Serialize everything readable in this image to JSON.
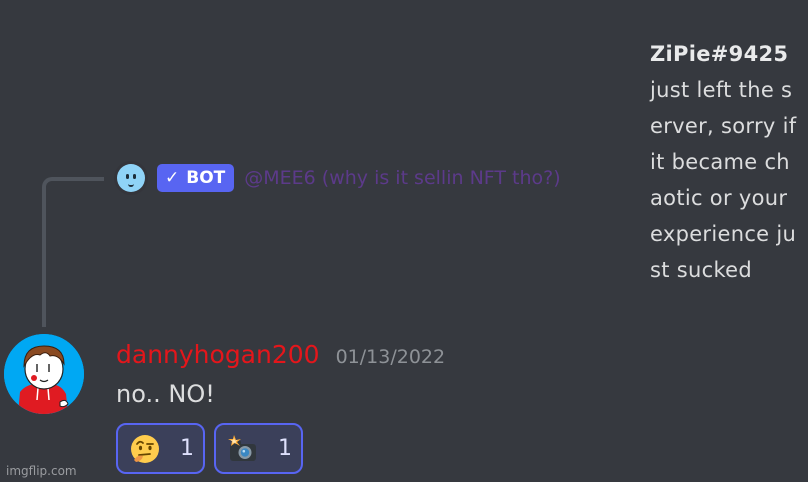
{
  "reply": {
    "bot_label": "BOT",
    "check_glyph": "✓",
    "text": "@MEE6 (why is it sellin NFT tho?)"
  },
  "side_note": {
    "bold": "ZiPie#9425",
    "text": " just left the server, sorry if it became chaotic or your experience just sucked"
  },
  "message": {
    "username": "dannyhogan200",
    "timestamp": "01/13/2022",
    "body": "no.. NO!"
  },
  "reactions": [
    {
      "emoji": "face-with-raised-eyebrow-icon",
      "count": "1"
    },
    {
      "emoji": "camera-with-flash-icon",
      "count": "1"
    }
  ],
  "watermark": "imgflip.com",
  "colors": {
    "background": "#36393f",
    "username": "#e4161b",
    "bot_tag": "#5865f2",
    "reply_text": "#5c3a8a",
    "reaction_border": "#5865f2"
  }
}
